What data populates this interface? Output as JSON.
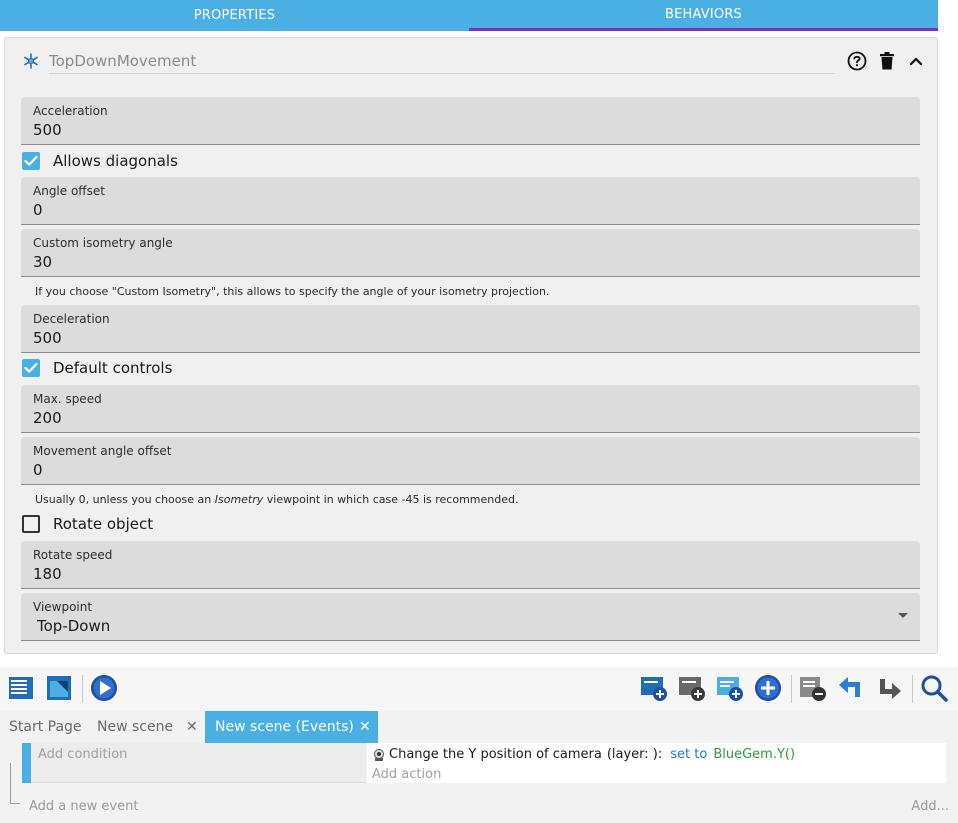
{
  "top_tabs": [
    {
      "label": "PROPERTIES",
      "active": false
    },
    {
      "label": "BEHAVIORS",
      "active": true
    }
  ],
  "behavior": {
    "name": "TopDownMovement",
    "icons": {
      "behavior": "snowflake-gear-icon",
      "help": "help-circle-icon",
      "delete": "trash-icon",
      "collapse": "chevron-up-icon"
    }
  },
  "fields": {
    "acceleration": {
      "label": "Acceleration",
      "value": "500"
    },
    "angle_offset": {
      "label": "Angle offset",
      "value": "0"
    },
    "custom_iso": {
      "label": "Custom isometry angle",
      "value": "30"
    },
    "deceleration": {
      "label": "Deceleration",
      "value": "500"
    },
    "max_speed": {
      "label": "Max. speed",
      "value": "200"
    },
    "movement_angle": {
      "label": "Movement angle offset",
      "value": "0"
    },
    "rotate_speed": {
      "label": "Rotate speed",
      "value": "180"
    },
    "viewpoint": {
      "label": "Viewpoint",
      "value": "Top-Down"
    }
  },
  "checks": {
    "allows_diagonals": {
      "label": "Allows diagonals",
      "checked": true
    },
    "default_controls": {
      "label": "Default controls",
      "checked": true
    },
    "rotate_object": {
      "label": "Rotate object",
      "checked": false
    }
  },
  "helpers": {
    "custom_iso": "If you choose \"Custom Isometry\", this allows to specify the angle of your isometry projection.",
    "movement_pre": "Usually 0, unless you choose an ",
    "movement_em": "Isometry",
    "movement_post": " viewpoint in which case -45 is recommended."
  },
  "editor_tabs": [
    {
      "label": "Start Page",
      "active": false
    },
    {
      "label": "New scene",
      "active": false
    },
    {
      "label": "New scene (Events)",
      "active": true
    }
  ],
  "editor_tab_close": "✕",
  "events": {
    "add_condition": "Add condition",
    "action_text": "Change the Y position of camera",
    "action_param": "(layer: ):",
    "action_op": "set to",
    "action_value": "BlueGem.Y()",
    "add_action": "Add action",
    "add_event": "Add a new event",
    "add_other": "Add..."
  },
  "colors": {
    "accent": "#4ab0e4",
    "active_tab_underline": "#7a2fbf",
    "field_bg": "#dcdcdc",
    "panel_bg": "#f0f0f0"
  }
}
